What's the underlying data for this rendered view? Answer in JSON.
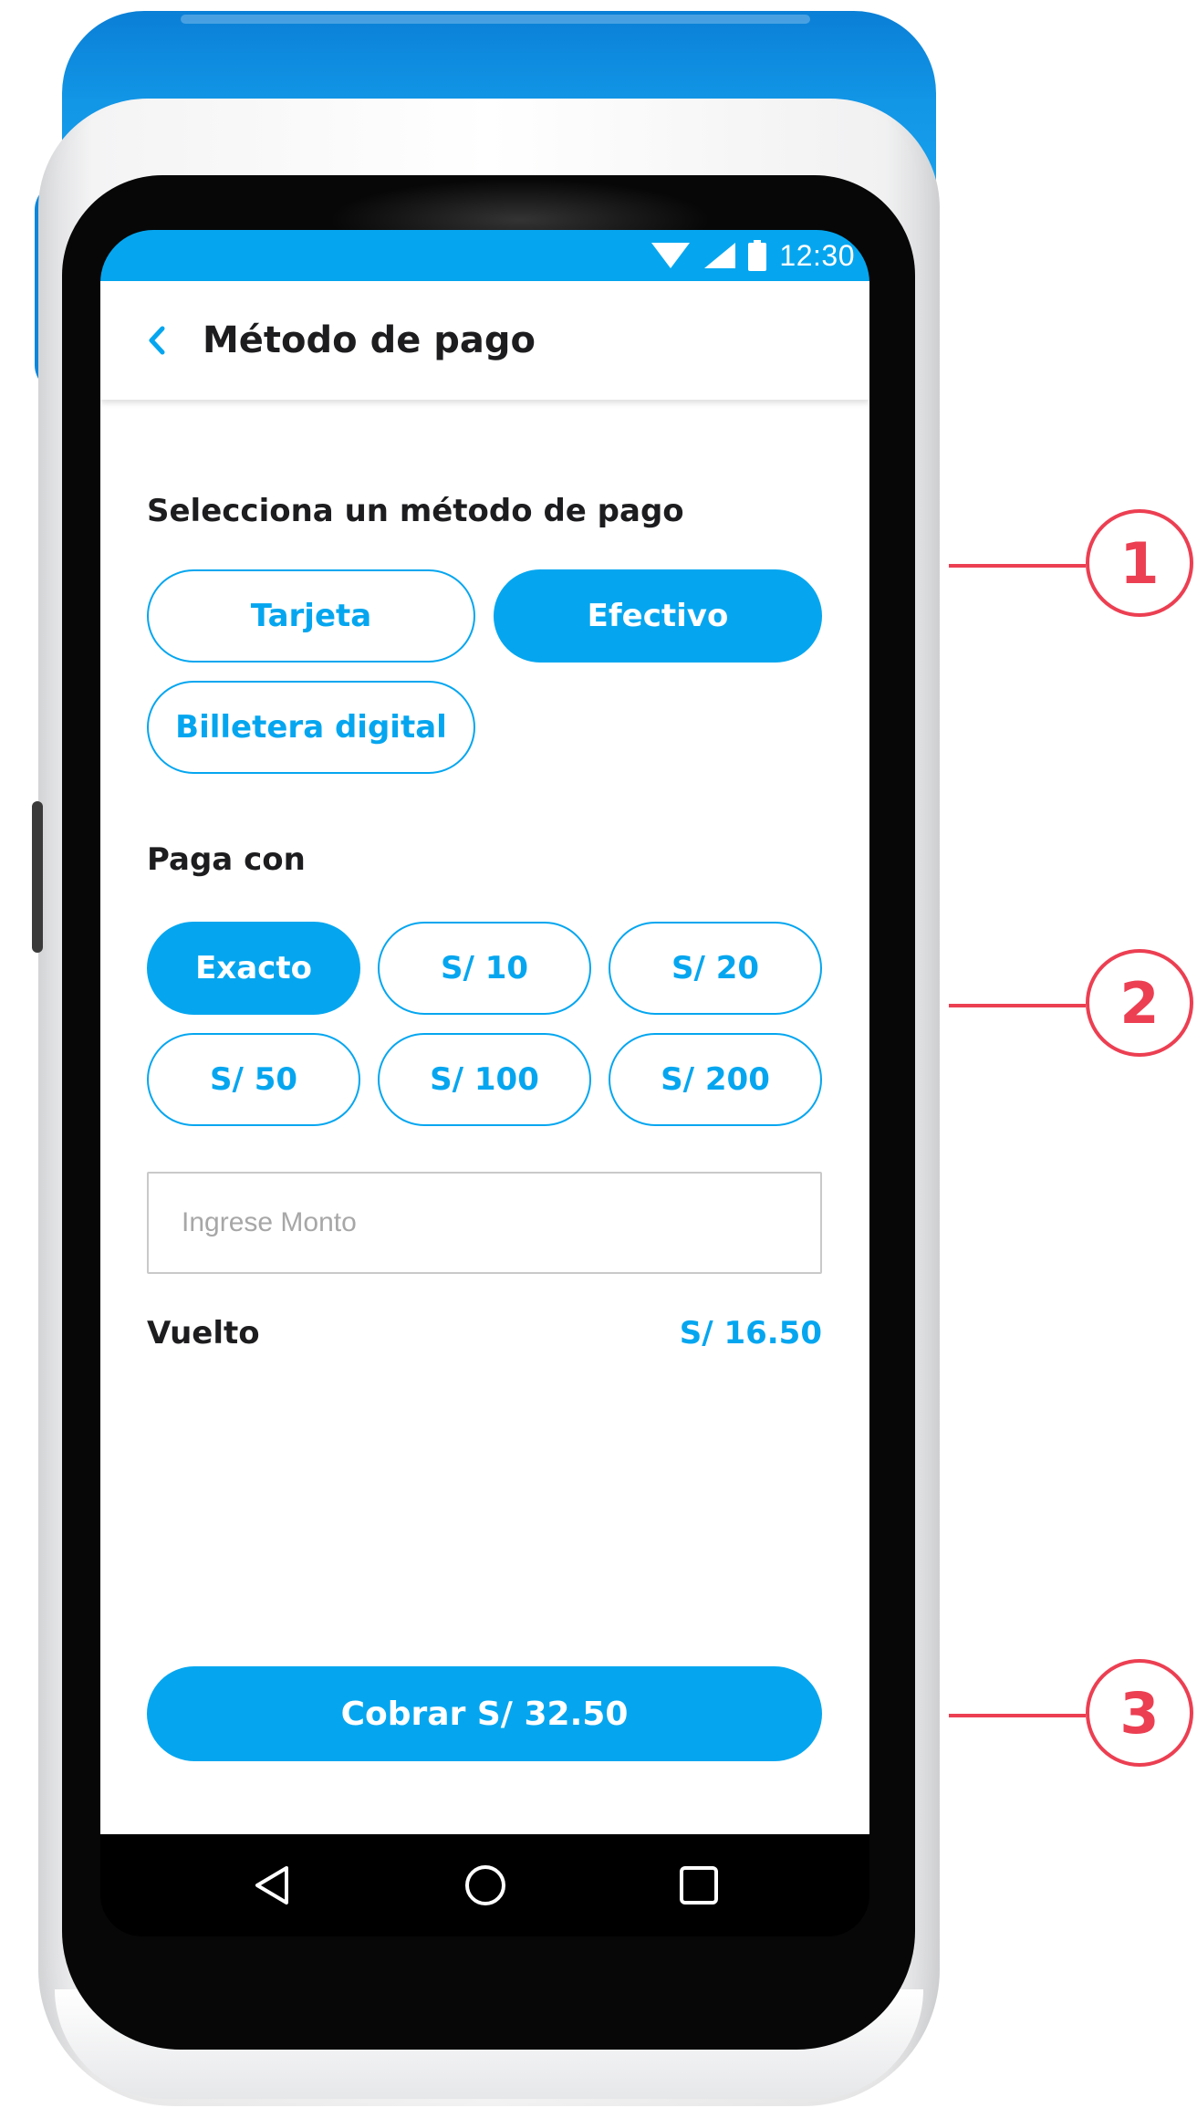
{
  "status_bar": {
    "time": "12:30",
    "icons": [
      "wifi-icon",
      "signal-icon",
      "battery-icon"
    ]
  },
  "app_bar": {
    "title": "Método de pago",
    "back_icon": "chevron-left-icon"
  },
  "payment_method": {
    "heading": "Selecciona un método de pago",
    "options": [
      {
        "label": "Tarjeta",
        "selected": false
      },
      {
        "label": "Efectivo",
        "selected": true
      },
      {
        "label": "Billetera digital",
        "selected": false
      }
    ]
  },
  "pay_with": {
    "heading": "Paga con",
    "options": [
      {
        "label": "Exacto",
        "selected": true
      },
      {
        "label": "S/ 10",
        "selected": false
      },
      {
        "label": "S/ 20",
        "selected": false
      },
      {
        "label": "S/ 50",
        "selected": false
      },
      {
        "label": "S/ 100",
        "selected": false
      },
      {
        "label": "S/ 200",
        "selected": false
      }
    ]
  },
  "amount_input": {
    "placeholder": "Ingrese Monto",
    "value": ""
  },
  "change": {
    "label": "Vuelto",
    "value": "S/ 16.50"
  },
  "charge_button": {
    "label": "Cobrar S/ 32.50"
  },
  "nav_bar": {
    "icons": [
      "back-triangle-icon",
      "home-circle-icon",
      "recents-square-icon"
    ]
  },
  "callouts": [
    "1",
    "2",
    "3"
  ],
  "colors": {
    "accent": "#05a6ef",
    "callout": "#ec3f52",
    "text": "#1d1d1f",
    "device_blue": "#1296e6"
  }
}
